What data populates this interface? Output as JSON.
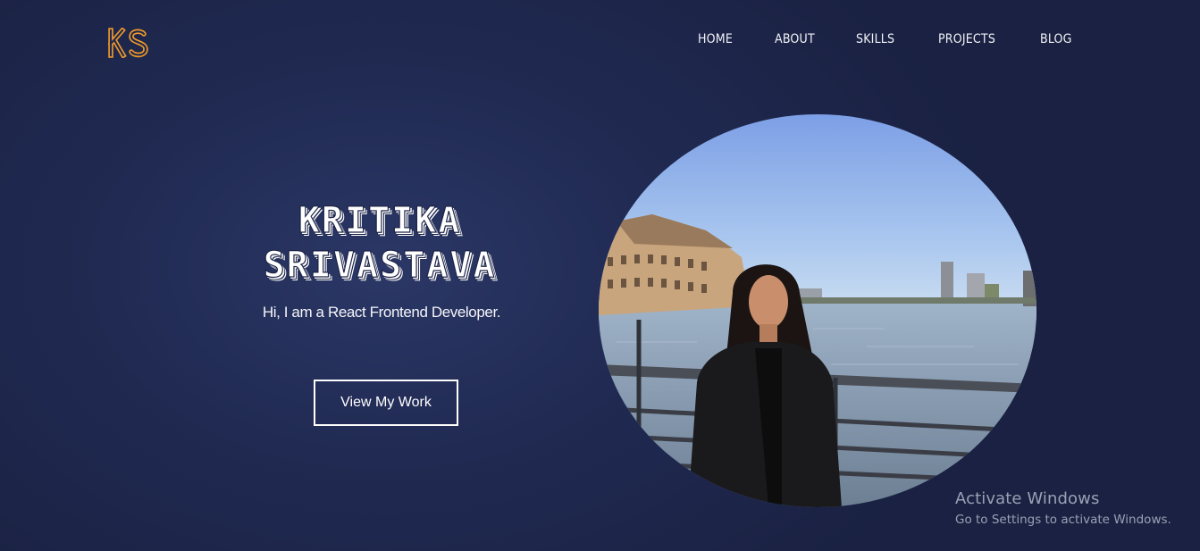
{
  "logo": {
    "text": "KS",
    "color": "#f29a27"
  },
  "nav": {
    "items": [
      {
        "label": "HOME"
      },
      {
        "label": "ABOUT"
      },
      {
        "label": "SKILLS"
      },
      {
        "label": "PROJECTS"
      },
      {
        "label": "BLOG"
      }
    ]
  },
  "hero": {
    "name_line1": "KRITIKA",
    "name_line2": "SRIVASTAVA",
    "subtitle": "Hi, I am a React Frontend Developer.",
    "button_label": "View My Work"
  },
  "watermark": {
    "title": "Activate Windows",
    "subtitle": "Go to Settings to activate Windows."
  },
  "colors": {
    "background": "#1f2850",
    "accent": "#f29a27",
    "text": "#ffffff"
  }
}
